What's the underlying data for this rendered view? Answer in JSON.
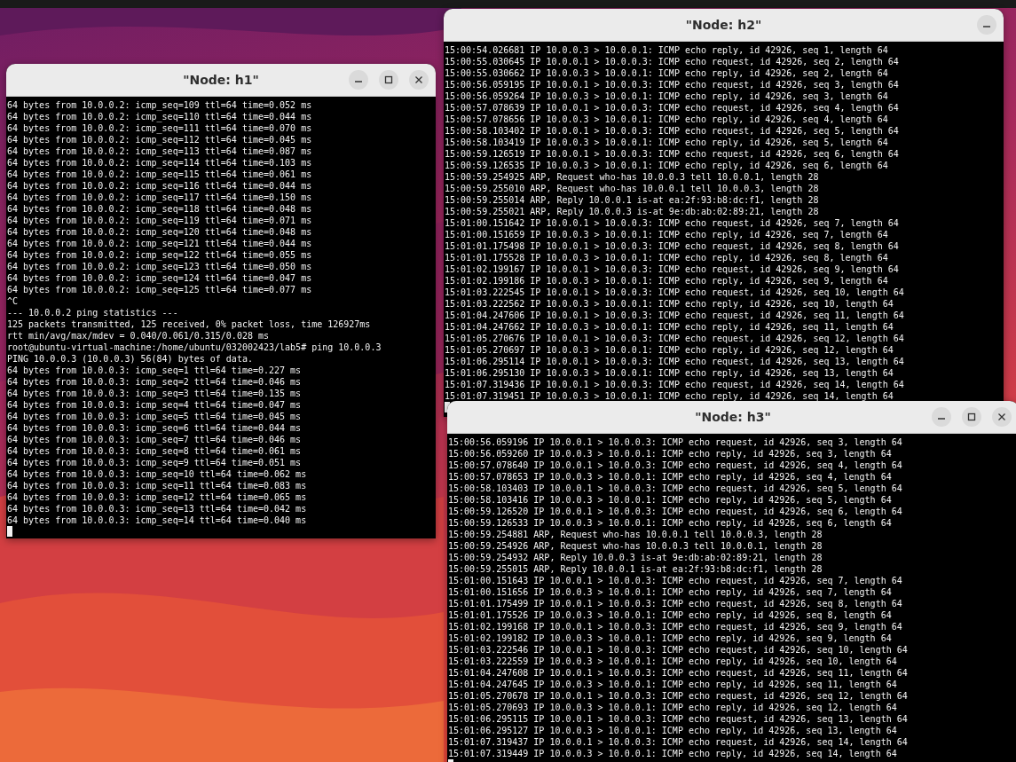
{
  "windows": [
    {
      "title": "\"Node: h1\"",
      "buttons": [
        {
          "kind": "minimize"
        },
        {
          "kind": "maximize"
        },
        {
          "kind": "close"
        }
      ],
      "cursor": true,
      "lines": [
        "64 bytes from 10.0.0.2: icmp_seq=109 ttl=64 time=0.052 ms",
        "64 bytes from 10.0.0.2: icmp_seq=110 ttl=64 time=0.044 ms",
        "64 bytes from 10.0.0.2: icmp_seq=111 ttl=64 time=0.070 ms",
        "64 bytes from 10.0.0.2: icmp_seq=112 ttl=64 time=0.045 ms",
        "64 bytes from 10.0.0.2: icmp_seq=113 ttl=64 time=0.087 ms",
        "64 bytes from 10.0.0.2: icmp_seq=114 ttl=64 time=0.103 ms",
        "64 bytes from 10.0.0.2: icmp_seq=115 ttl=64 time=0.061 ms",
        "64 bytes from 10.0.0.2: icmp_seq=116 ttl=64 time=0.044 ms",
        "64 bytes from 10.0.0.2: icmp_seq=117 ttl=64 time=0.150 ms",
        "64 bytes from 10.0.0.2: icmp_seq=118 ttl=64 time=0.048 ms",
        "64 bytes from 10.0.0.2: icmp_seq=119 ttl=64 time=0.071 ms",
        "64 bytes from 10.0.0.2: icmp_seq=120 ttl=64 time=0.048 ms",
        "64 bytes from 10.0.0.2: icmp_seq=121 ttl=64 time=0.044 ms",
        "64 bytes from 10.0.0.2: icmp_seq=122 ttl=64 time=0.055 ms",
        "64 bytes from 10.0.0.2: icmp_seq=123 ttl=64 time=0.050 ms",
        "64 bytes from 10.0.0.2: icmp_seq=124 ttl=64 time=0.047 ms",
        "64 bytes from 10.0.0.2: icmp_seq=125 ttl=64 time=0.077 ms",
        "^C",
        "--- 10.0.0.2 ping statistics ---",
        "125 packets transmitted, 125 received, 0% packet loss, time 126927ms",
        "rtt min/avg/max/mdev = 0.040/0.061/0.315/0.028 ms",
        "root@ubuntu-virtual-machine:/home/ubuntu/032002423/lab5# ping 10.0.0.3",
        "PING 10.0.0.3 (10.0.0.3) 56(84) bytes of data.",
        "64 bytes from 10.0.0.3: icmp_seq=1 ttl=64 time=0.227 ms",
        "64 bytes from 10.0.0.3: icmp_seq=2 ttl=64 time=0.046 ms",
        "64 bytes from 10.0.0.3: icmp_seq=3 ttl=64 time=0.135 ms",
        "64 bytes from 10.0.0.3: icmp_seq=4 ttl=64 time=0.047 ms",
        "64 bytes from 10.0.0.3: icmp_seq=5 ttl=64 time=0.045 ms",
        "64 bytes from 10.0.0.3: icmp_seq=6 ttl=64 time=0.044 ms",
        "64 bytes from 10.0.0.3: icmp_seq=7 ttl=64 time=0.046 ms",
        "64 bytes from 10.0.0.3: icmp_seq=8 ttl=64 time=0.061 ms",
        "64 bytes from 10.0.0.3: icmp_seq=9 ttl=64 time=0.051 ms",
        "64 bytes from 10.0.0.3: icmp_seq=10 ttl=64 time=0.062 ms",
        "64 bytes from 10.0.0.3: icmp_seq=11 ttl=64 time=0.083 ms",
        "64 bytes from 10.0.0.3: icmp_seq=12 ttl=64 time=0.065 ms",
        "64 bytes from 10.0.0.3: icmp_seq=13 ttl=64 time=0.042 ms",
        "64 bytes from 10.0.0.3: icmp_seq=14 ttl=64 time=0.040 ms"
      ]
    },
    {
      "title": "\"Node: h2\"",
      "buttons": [
        {
          "kind": "minimize"
        }
      ],
      "cursor": true,
      "lines": [
        "15:00:54.026681 IP 10.0.0.3 > 10.0.0.1: ICMP echo reply, id 42926, seq 1, length 64",
        "15:00:55.030645 IP 10.0.0.1 > 10.0.0.3: ICMP echo request, id 42926, seq 2, length 64",
        "15:00:55.030662 IP 10.0.0.3 > 10.0.0.1: ICMP echo reply, id 42926, seq 2, length 64",
        "15:00:56.059195 IP 10.0.0.1 > 10.0.0.3: ICMP echo request, id 42926, seq 3, length 64",
        "15:00:56.059264 IP 10.0.0.3 > 10.0.0.1: ICMP echo reply, id 42926, seq 3, length 64",
        "15:00:57.078639 IP 10.0.0.1 > 10.0.0.3: ICMP echo request, id 42926, seq 4, length 64",
        "15:00:57.078656 IP 10.0.0.3 > 10.0.0.1: ICMP echo reply, id 42926, seq 4, length 64",
        "15:00:58.103402 IP 10.0.0.1 > 10.0.0.3: ICMP echo request, id 42926, seq 5, length 64",
        "15:00:58.103419 IP 10.0.0.3 > 10.0.0.1: ICMP echo reply, id 42926, seq 5, length 64",
        "15:00:59.126519 IP 10.0.0.1 > 10.0.0.3: ICMP echo request, id 42926, seq 6, length 64",
        "15:00:59.126535 IP 10.0.0.3 > 10.0.0.1: ICMP echo reply, id 42926, seq 6, length 64",
        "15:00:59.254925 ARP, Request who-has 10.0.0.3 tell 10.0.0.1, length 28",
        "15:00:59.255010 ARP, Request who-has 10.0.0.1 tell 10.0.0.3, length 28",
        "15:00:59.255014 ARP, Reply 10.0.0.1 is-at ea:2f:93:b8:dc:f1, length 28",
        "15:00:59.255021 ARP, Reply 10.0.0.3 is-at 9e:db:ab:02:89:21, length 28",
        "15:01:00.151642 IP 10.0.0.1 > 10.0.0.3: ICMP echo request, id 42926, seq 7, length 64",
        "15:01:00.151659 IP 10.0.0.3 > 10.0.0.1: ICMP echo reply, id 42926, seq 7, length 64",
        "15:01:01.175498 IP 10.0.0.1 > 10.0.0.3: ICMP echo request, id 42926, seq 8, length 64",
        "15:01:01.175528 IP 10.0.0.3 > 10.0.0.1: ICMP echo reply, id 42926, seq 8, length 64",
        "15:01:02.199167 IP 10.0.0.1 > 10.0.0.3: ICMP echo request, id 42926, seq 9, length 64",
        "15:01:02.199186 IP 10.0.0.3 > 10.0.0.1: ICMP echo reply, id 42926, seq 9, length 64",
        "15:01:03.222545 IP 10.0.0.1 > 10.0.0.3: ICMP echo request, id 42926, seq 10, length 64",
        "15:01:03.222562 IP 10.0.0.3 > 10.0.0.1: ICMP echo reply, id 42926, seq 10, length 64",
        "15:01:04.247606 IP 10.0.0.1 > 10.0.0.3: ICMP echo request, id 42926, seq 11, length 64",
        "15:01:04.247662 IP 10.0.0.3 > 10.0.0.1: ICMP echo reply, id 42926, seq 11, length 64",
        "15:01:05.270676 IP 10.0.0.1 > 10.0.0.3: ICMP echo request, id 42926, seq 12, length 64",
        "15:01:05.270697 IP 10.0.0.3 > 10.0.0.1: ICMP echo reply, id 42926, seq 12, length 64",
        "15:01:06.295114 IP 10.0.0.1 > 10.0.0.3: ICMP echo request, id 42926, seq 13, length 64",
        "15:01:06.295130 IP 10.0.0.3 > 10.0.0.1: ICMP echo reply, id 42926, seq 13, length 64",
        "15:01:07.319436 IP 10.0.0.1 > 10.0.0.3: ICMP echo request, id 42926, seq 14, length 64",
        "15:01:07.319451 IP 10.0.0.3 > 10.0.0.1: ICMP echo reply, id 42926, seq 14, length 64"
      ]
    },
    {
      "title": "\"Node: h3\"",
      "buttons": [
        {
          "kind": "minimize"
        },
        {
          "kind": "maximize"
        },
        {
          "kind": "close"
        }
      ],
      "cursor": true,
      "lines": [
        "15:00:56.059196 IP 10.0.0.1 > 10.0.0.3: ICMP echo request, id 42926, seq 3, length 64",
        "15:00:56.059260 IP 10.0.0.3 > 10.0.0.1: ICMP echo reply, id 42926, seq 3, length 64",
        "15:00:57.078640 IP 10.0.0.1 > 10.0.0.3: ICMP echo request, id 42926, seq 4, length 64",
        "15:00:57.078653 IP 10.0.0.3 > 10.0.0.1: ICMP echo reply, id 42926, seq 4, length 64",
        "15:00:58.103403 IP 10.0.0.1 > 10.0.0.3: ICMP echo request, id 42926, seq 5, length 64",
        "15:00:58.103416 IP 10.0.0.3 > 10.0.0.1: ICMP echo reply, id 42926, seq 5, length 64",
        "15:00:59.126520 IP 10.0.0.1 > 10.0.0.3: ICMP echo request, id 42926, seq 6, length 64",
        "15:00:59.126533 IP 10.0.0.3 > 10.0.0.1: ICMP echo reply, id 42926, seq 6, length 64",
        "15:00:59.254881 ARP, Request who-has 10.0.0.1 tell 10.0.0.3, length 28",
        "15:00:59.254926 ARP, Request who-has 10.0.0.3 tell 10.0.0.1, length 28",
        "15:00:59.254932 ARP, Reply 10.0.0.3 is-at 9e:db:ab:02:89:21, length 28",
        "15:00:59.255015 ARP, Reply 10.0.0.1 is-at ea:2f:93:b8:dc:f1, length 28",
        "15:01:00.151643 IP 10.0.0.1 > 10.0.0.3: ICMP echo request, id 42926, seq 7, length 64",
        "15:01:00.151656 IP 10.0.0.3 > 10.0.0.1: ICMP echo reply, id 42926, seq 7, length 64",
        "15:01:01.175499 IP 10.0.0.1 > 10.0.0.3: ICMP echo request, id 42926, seq 8, length 64",
        "15:01:01.175526 IP 10.0.0.3 > 10.0.0.1: ICMP echo reply, id 42926, seq 8, length 64",
        "15:01:02.199168 IP 10.0.0.1 > 10.0.0.3: ICMP echo request, id 42926, seq 9, length 64",
        "15:01:02.199182 IP 10.0.0.3 > 10.0.0.1: ICMP echo reply, id 42926, seq 9, length 64",
        "15:01:03.222546 IP 10.0.0.1 > 10.0.0.3: ICMP echo request, id 42926, seq 10, length 64",
        "15:01:03.222559 IP 10.0.0.3 > 10.0.0.1: ICMP echo reply, id 42926, seq 10, length 64",
        "15:01:04.247608 IP 10.0.0.1 > 10.0.0.3: ICMP echo request, id 42926, seq 11, length 64",
        "15:01:04.247645 IP 10.0.0.3 > 10.0.0.1: ICMP echo reply, id 42926, seq 11, length 64",
        "15:01:05.270678 IP 10.0.0.1 > 10.0.0.3: ICMP echo request, id 42926, seq 12, length 64",
        "15:01:05.270693 IP 10.0.0.3 > 10.0.0.1: ICMP echo reply, id 42926, seq 12, length 64",
        "15:01:06.295115 IP 10.0.0.1 > 10.0.0.3: ICMP echo request, id 42926, seq 13, length 64",
        "15:01:06.295127 IP 10.0.0.3 > 10.0.0.1: ICMP echo reply, id 42926, seq 13, length 64",
        "15:01:07.319437 IP 10.0.0.1 > 10.0.0.3: ICMP echo request, id 42926, seq 14, length 64",
        "15:01:07.319449 IP 10.0.0.3 > 10.0.0.1: ICMP echo reply, id 42926, seq 14, length 64"
      ]
    }
  ]
}
